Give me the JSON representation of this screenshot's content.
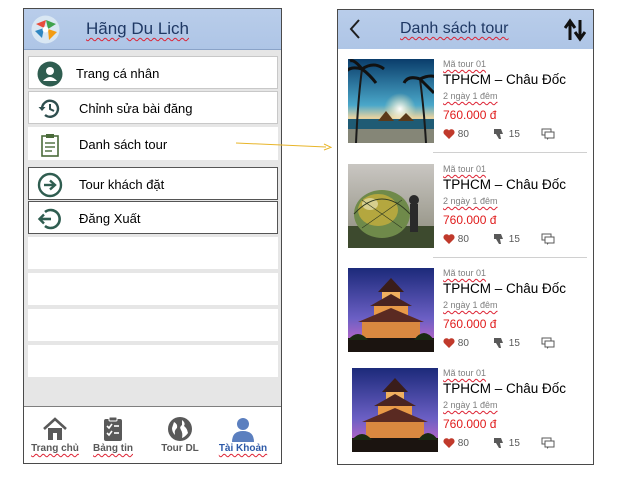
{
  "left_screen": {
    "title": "Hãng Du Lich",
    "menu": [
      {
        "label": "Trang cá nhân",
        "icon": "user-icon"
      },
      {
        "label": "Chỉnh sửa bài đăng",
        "icon": "history-icon"
      },
      {
        "label": "Danh sách tour",
        "icon": "clipboard-icon"
      },
      {
        "label": "Tour khách đặt",
        "icon": "arrow-right-circle-icon"
      },
      {
        "label": "Đăng Xuất",
        "icon": "logout-icon"
      }
    ],
    "bottom_nav": [
      {
        "label": "Trang chủ",
        "icon": "home-icon",
        "active": false
      },
      {
        "label": "Bảng tin",
        "icon": "checklist-icon",
        "active": false
      },
      {
        "label": "Tour DL",
        "icon": "globe-icon",
        "active": false
      },
      {
        "label": "Tài Khoản",
        "icon": "person-icon",
        "active": true
      }
    ]
  },
  "right_screen": {
    "title": "Danh sách tour",
    "tours": [
      {
        "code": "Mã tour 01",
        "name": "TPHCM – Châu Đốc",
        "duration": "2 ngày 1 đêm",
        "price": "760.000 đ",
        "likes": "80",
        "dislikes": "15",
        "image": "beach-sunset-image"
      },
      {
        "code": "Mã tour 01",
        "name": "TPHCM – Châu Đốc",
        "duration": "2 ngày 1 đêm",
        "price": "760.000 đ",
        "likes": "80",
        "dislikes": "15",
        "image": "glass-dome-image"
      },
      {
        "code": "Mã tour 01",
        "name": "TPHCM – Châu Đốc",
        "duration": "2 ngày 1 đêm",
        "price": "760.000 đ",
        "likes": "80",
        "dislikes": "15",
        "image": "pagoda-night-image"
      },
      {
        "code": "Mã tour 01",
        "name": "TPHCM – Châu Đốc",
        "duration": "2 ngày 1 đêm",
        "price": "760.000 đ",
        "likes": "80",
        "dislikes": "15",
        "image": "pagoda-night-image"
      }
    ]
  },
  "colors": {
    "header": "#aec5e6",
    "title_text": "#1f3864",
    "price": "#e01b1b",
    "heart": "#c0392b",
    "icon_dark": "#2f4f4f"
  }
}
